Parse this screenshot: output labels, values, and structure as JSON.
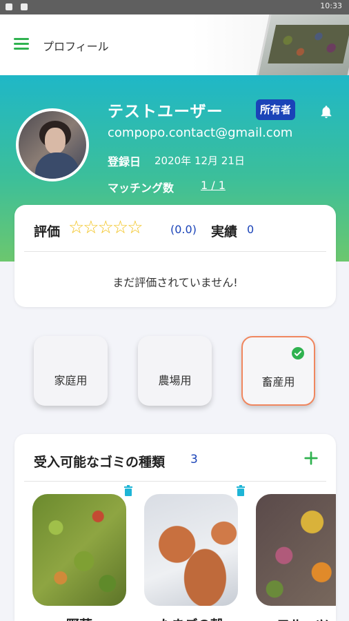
{
  "status_bar": {
    "time": "10:33"
  },
  "app_bar": {
    "title": "プロフィール"
  },
  "profile": {
    "name": "テストユーザー",
    "role_badge": "所有者",
    "email": "compopo.contact@gmail.com",
    "registered_label": "登録日",
    "registered_date": "2020年 12月 21日",
    "matching_label": "マッチング数",
    "matching_value": "1 / 1"
  },
  "rating": {
    "label": "評価",
    "stars": "☆☆☆☆☆",
    "star_count": 5,
    "filled_stars": 0,
    "score": "(0.0)",
    "record_label": "実績",
    "record_value": "0",
    "empty_message": "まだ評価されていません!"
  },
  "usage_types": [
    {
      "label": "家庭用",
      "selected": false
    },
    {
      "label": "農場用",
      "selected": false
    },
    {
      "label": "畜産用",
      "selected": true
    }
  ],
  "waste": {
    "title": "受入可能なゴミの種類",
    "count": "3",
    "items": [
      {
        "name": "野菜"
      },
      {
        "name": "たまごの殻"
      },
      {
        "name": "フルーツ"
      }
    ]
  },
  "colors": {
    "accent_green": "#2fb24f",
    "badge_blue": "#1a43b8",
    "selected_border": "#f0865e",
    "star_yellow": "#f2c21b"
  },
  "icons": [
    "menu-icon",
    "bell-icon",
    "check-icon",
    "add-icon",
    "trash-icon"
  ]
}
